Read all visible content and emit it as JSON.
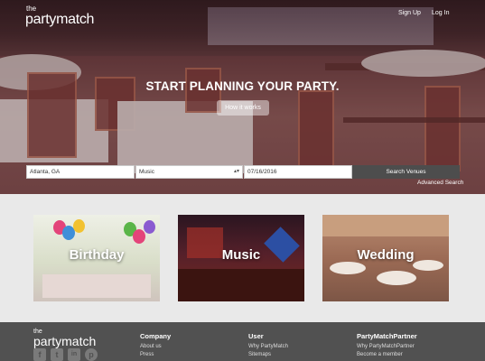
{
  "header": {
    "logo_small": "the",
    "logo_main": "partymatch",
    "signup_label": "Sign Up",
    "login_label": "Log In"
  },
  "hero": {
    "headline": "START PLANNING YOUR PARTY.",
    "how_label": "How it works"
  },
  "search": {
    "location_value": "Atlanta, GA",
    "category_value": "Music",
    "date_value": "07/16/2016",
    "submit_label": "Search Venues",
    "advanced_label": "Advanced Search"
  },
  "categories": [
    {
      "label": "Birthday"
    },
    {
      "label": "Music"
    },
    {
      "label": "Wedding"
    }
  ],
  "footer": {
    "logo_small": "the",
    "logo_main": "partymatch",
    "social_icons": [
      "facebook-icon",
      "twitter-icon",
      "linkedin-icon",
      "pinterest-icon"
    ],
    "social_glyphs": [
      "f",
      "t",
      "in",
      "p"
    ],
    "columns": [
      {
        "heading": "Company",
        "links": [
          "About us",
          "Press"
        ]
      },
      {
        "heading": "User",
        "links": [
          "Why PartyMatch",
          "Sitemaps"
        ]
      },
      {
        "heading": "PartyMatchPartner",
        "links": [
          "Why PartyMatchPartner",
          "Become a member"
        ]
      }
    ]
  },
  "colors": {
    "footer_bg": "#515151",
    "search_button": "#4d4d4d",
    "page_bg": "#e9e9e9"
  }
}
